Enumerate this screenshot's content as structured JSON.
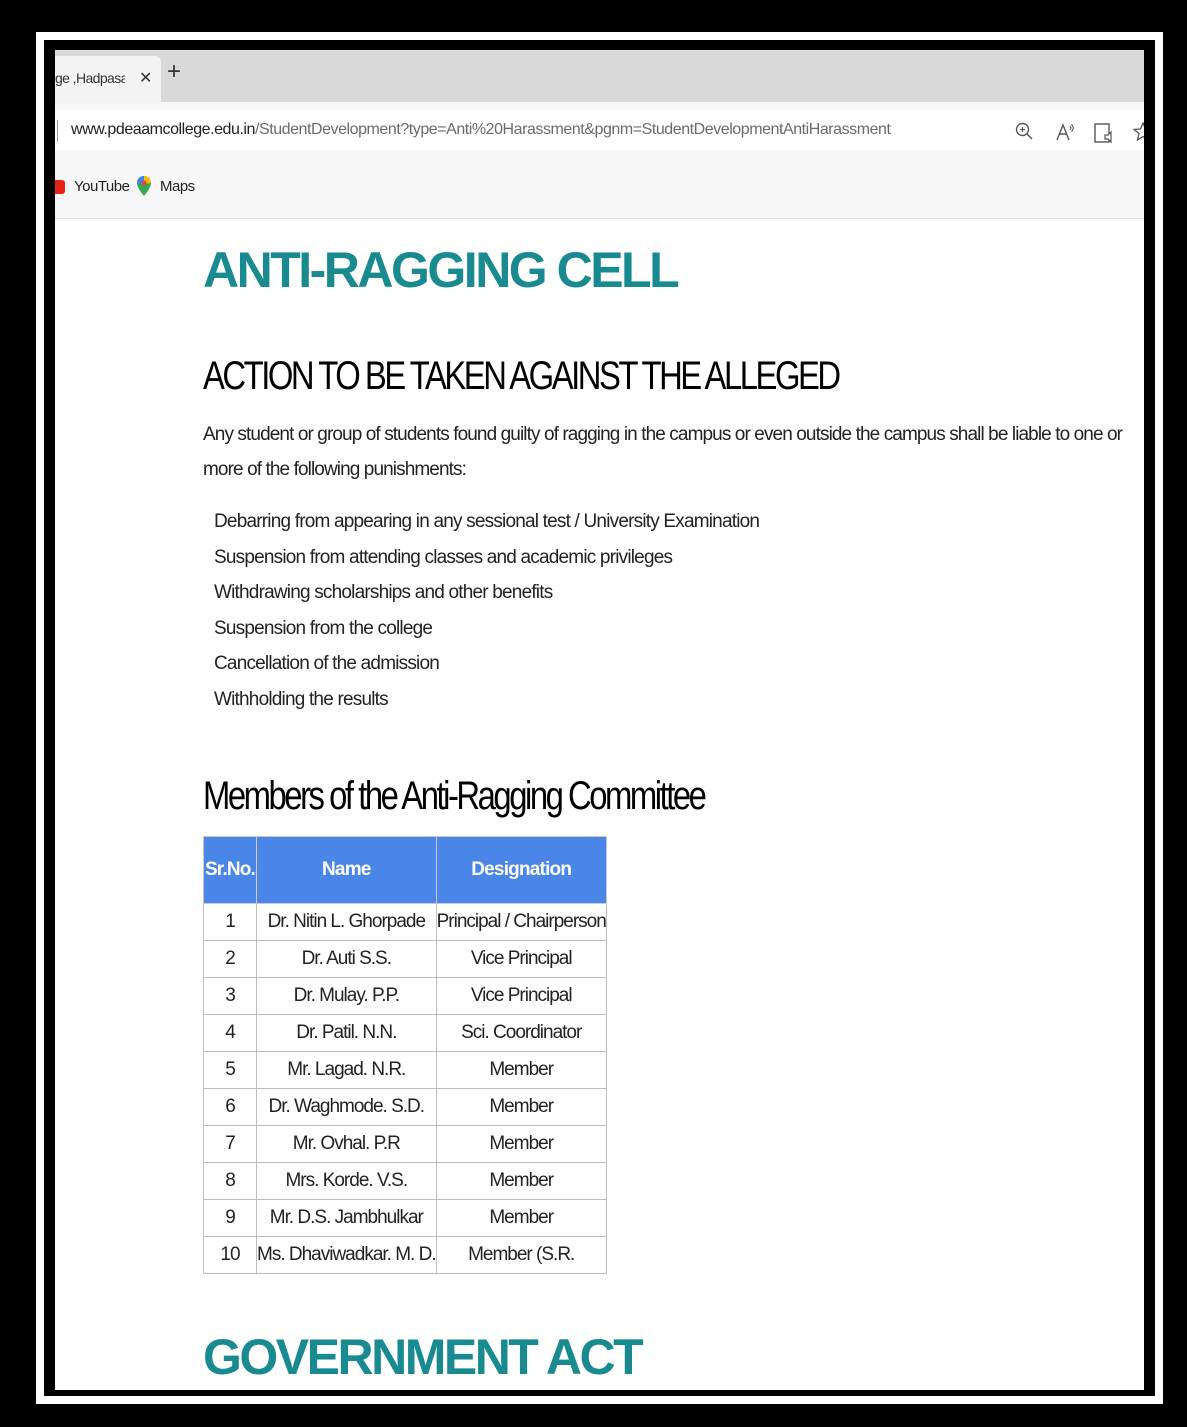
{
  "browser": {
    "tab_title": "ge ,Hadpasar ,",
    "tab_close": "✕",
    "new_tab": "+",
    "url_domain": "www.pdeaamcollege.edu.in",
    "url_path": "/StudentDevelopment?type=Anti%20Harassment&pgnm=StudentDevelopmentAntiHarassment",
    "icons": [
      "zoom-icon",
      "read-aloud-icon",
      "immersive-reader-icon",
      "favorite-icon"
    ]
  },
  "bookmarks": [
    {
      "label": "YouTube",
      "icon": "youtube-icon"
    },
    {
      "label": "Maps",
      "icon": "maps-icon"
    }
  ],
  "page": {
    "title": "ANTI-RAGGING CELL",
    "action_heading": "ACTION TO BE TAKEN AGAINST THE ALLEGED",
    "intro": "Any student or group of students found guilty of ragging in the campus or even outside the campus shall be liable to one or more of the following punishments:",
    "punishments": [
      "Debarring from appearing in any sessional test / University Examination",
      "Suspension from attending classes and academic privileges",
      "Withdrawing scholarships and other benefits",
      "Suspension from the college",
      "Cancellation of the admission",
      "Withholding the results"
    ],
    "members_heading": "Members of the Anti-Ragging Committee",
    "table_headers": [
      "Sr.No.",
      "Name",
      "Designation"
    ],
    "members": [
      [
        "1",
        "Dr. Nitin L. Ghorpade",
        "Principal / Chairperson"
      ],
      [
        "2",
        "Dr. Auti S.S.",
        "Vice Principal"
      ],
      [
        "3",
        "Dr. Mulay. P.P.",
        "Vice Principal"
      ],
      [
        "4",
        "Dr. Patil. N.N.",
        "Sci. Coordinator"
      ],
      [
        "5",
        "Mr. Lagad. N.R.",
        "Member"
      ],
      [
        "6",
        "Dr. Waghmode. S.D.",
        "Member"
      ],
      [
        "7",
        "Mr. Ovhal. P.R",
        "Member"
      ],
      [
        "8",
        "Mrs. Korde. V.S.",
        "Member"
      ],
      [
        "9",
        "Mr. D.S. Jambhulkar",
        "Member"
      ],
      [
        "10",
        "Ms. Dhaviwadkar. M. D.",
        "Member (S.R."
      ]
    ],
    "gov_heading": "GOVERNMENT ACT"
  },
  "colors": {
    "heading_teal": "#1a8a91",
    "table_header_bg": "#4a86e8"
  }
}
